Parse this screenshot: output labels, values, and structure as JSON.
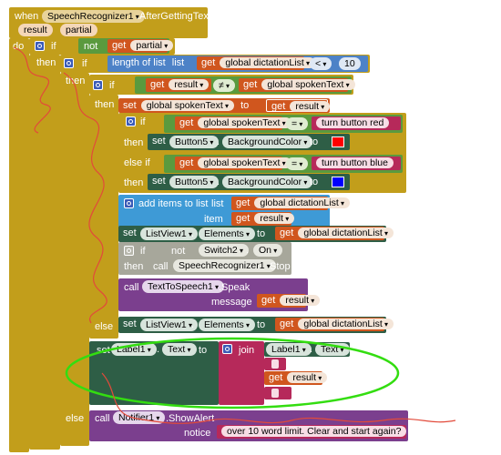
{
  "event": {
    "when": "when",
    "component": "SpeechRecognizer1",
    "event_name": ".AfterGettingText",
    "params": [
      "result",
      "partial"
    ]
  },
  "kw": {
    "do": "do",
    "if": "if",
    "then": "then",
    "else": "else",
    "else_if": "else if",
    "set": "set",
    "to": "to",
    "get": "get",
    "call": "call",
    "not": "not",
    "join": "join",
    "item": "item",
    "list": "list",
    "message": "message",
    "notice": "notice"
  },
  "cond1": {
    "get": "get",
    "var": "partial"
  },
  "cond2": {
    "length_label": "length of list",
    "list_label": "list",
    "var": "global dictationList",
    "op": "<",
    "num": "10"
  },
  "cond3": {
    "var_left": "result",
    "op": "≠",
    "var_right": "global spokenText"
  },
  "set_spoken": {
    "var": "global spokenText",
    "value": "result"
  },
  "inner_if1": {
    "var": "global spokenText",
    "op": "=",
    "text": "turn button red"
  },
  "set_btn_red": {
    "component": "Button5",
    "property": "BackgroundColor",
    "color": "#ff0000"
  },
  "inner_if2": {
    "var": "global spokenText",
    "op": "=",
    "text": "turn button blue"
  },
  "set_btn_blue": {
    "component": "Button5",
    "property": "BackgroundColor",
    "color": "#0000ff"
  },
  "add_items": {
    "label": "add items to list",
    "list_var": "global dictationList",
    "item_var": "result"
  },
  "set_listview": {
    "component": "ListView1",
    "property": "Elements",
    "var": "global dictationList"
  },
  "if_switch": {
    "component": "Switch2",
    "property": "On",
    "call_component": "SpeechRecognizer1",
    "method": "Stop"
  },
  "speak": {
    "component": "TextToSpeech1",
    "method": ".Speak",
    "arg": "result"
  },
  "else_listview": {
    "component": "ListView1",
    "property": "Elements",
    "var": "global dictationList"
  },
  "set_label": {
    "component": "Label1",
    "property": "Text",
    "join_component": "Label1",
    "join_property": "Text",
    "get_var": "result"
  },
  "alert": {
    "component": "Notifier1",
    "method": ".ShowAlert",
    "text": "over 10 word limit. Clear and start again?"
  }
}
